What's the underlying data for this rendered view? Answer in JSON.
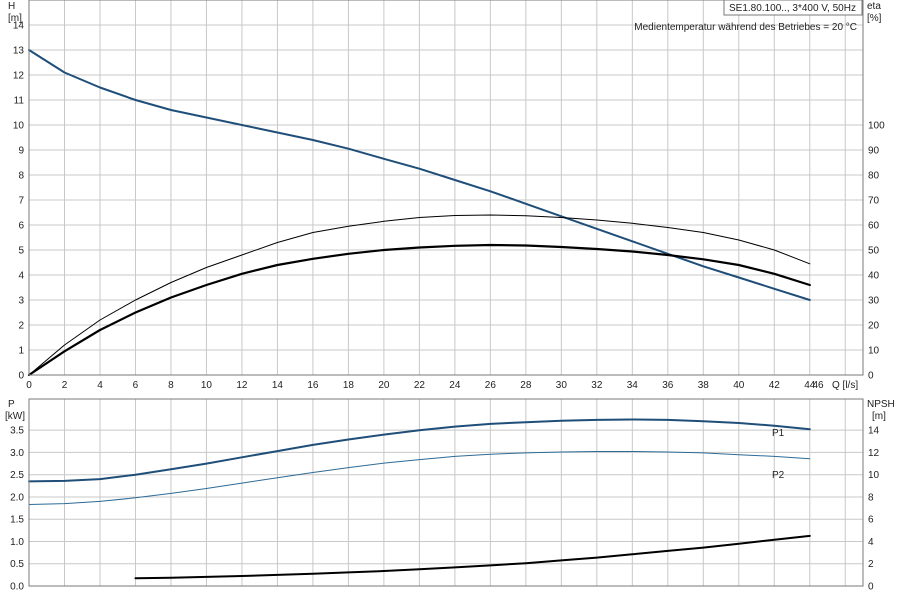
{
  "header": {
    "model": "SE1.80.100.., 3*400 V, 50Hz",
    "note": "Medientemperatur während des Betriebes = 20 °C"
  },
  "colors": {
    "head": "#1f4e79",
    "eta": "#000000",
    "p1": "#1f4e79",
    "p2": "#2e6a96",
    "npsh": "#000000",
    "grid": "#c8c8c8"
  },
  "chart_data": [
    {
      "type": "line",
      "xlabel": "Q [l/s]",
      "x_axis": {
        "label_prefix": "46",
        "label_unit": "Q [l/s]",
        "range": [
          0,
          47
        ],
        "ticks": [
          "0",
          "2",
          "4",
          "6",
          "8",
          "10",
          "12",
          "14",
          "16",
          "18",
          "20",
          "22",
          "24",
          "26",
          "28",
          "30",
          "32",
          "34",
          "36",
          "38",
          "40",
          "42",
          "44"
        ],
        "grid_step": 2
      },
      "y_left": {
        "label": "H",
        "unit": "[m]",
        "range": [
          0,
          15
        ],
        "ticks": [
          "0",
          "1",
          "2",
          "3",
          "4",
          "5",
          "6",
          "7",
          "8",
          "9",
          "10",
          "11",
          "12",
          "13",
          "14"
        ]
      },
      "y_right": {
        "label": "eta",
        "unit": "[%]",
        "range": [
          0,
          150
        ],
        "ticks": [
          "0",
          "10",
          "20",
          "30",
          "40",
          "50",
          "60",
          "70",
          "80",
          "90",
          "100"
        ]
      },
      "grid": true,
      "series": [
        {
          "key": "head",
          "axis": "left",
          "width": 2,
          "points": [
            [
              0,
              13.0
            ],
            [
              2,
              12.1
            ],
            [
              4,
              11.5
            ],
            [
              6,
              11.0
            ],
            [
              8,
              10.6
            ],
            [
              10,
              10.3
            ],
            [
              12,
              10.0
            ],
            [
              14,
              9.7
            ],
            [
              16,
              9.4
            ],
            [
              18,
              9.05
            ],
            [
              20,
              8.65
            ],
            [
              22,
              8.25
            ],
            [
              24,
              7.8
            ],
            [
              26,
              7.35
            ],
            [
              28,
              6.85
            ],
            [
              30,
              6.35
            ],
            [
              32,
              5.85
            ],
            [
              34,
              5.35
            ],
            [
              36,
              4.85
            ],
            [
              38,
              4.35
            ],
            [
              40,
              3.9
            ],
            [
              42,
              3.45
            ],
            [
              44,
              3.0
            ]
          ]
        },
        {
          "key": "eta_total",
          "axis": "right",
          "width": 2.2,
          "points": [
            [
              0,
              0
            ],
            [
              2,
              9.5
            ],
            [
              4,
              18
            ],
            [
              6,
              25
            ],
            [
              8,
              31
            ],
            [
              10,
              36
            ],
            [
              12,
              40.5
            ],
            [
              14,
              44
            ],
            [
              16,
              46.5
            ],
            [
              18,
              48.5
            ],
            [
              20,
              50
            ],
            [
              22,
              51
            ],
            [
              24,
              51.7
            ],
            [
              26,
              52
            ],
            [
              28,
              51.8
            ],
            [
              30,
              51.2
            ],
            [
              32,
              50.4
            ],
            [
              34,
              49.4
            ],
            [
              36,
              48
            ],
            [
              38,
              46.3
            ],
            [
              40,
              44
            ],
            [
              42,
              40.5
            ],
            [
              44,
              36
            ]
          ]
        },
        {
          "key": "eta_hydraulic",
          "axis": "right",
          "width": 1,
          "points": [
            [
              0,
              0
            ],
            [
              2,
              12
            ],
            [
              4,
              22
            ],
            [
              6,
              30
            ],
            [
              8,
              37
            ],
            [
              10,
              43
            ],
            [
              12,
              48
            ],
            [
              14,
              53
            ],
            [
              16,
              57
            ],
            [
              18,
              59.5
            ],
            [
              20,
              61.5
            ],
            [
              22,
              63
            ],
            [
              24,
              63.8
            ],
            [
              26,
              64
            ],
            [
              28,
              63.7
            ],
            [
              30,
              63
            ],
            [
              32,
              62
            ],
            [
              34,
              60.7
            ],
            [
              36,
              59
            ],
            [
              38,
              57
            ],
            [
              40,
              54
            ],
            [
              42,
              50
            ],
            [
              44,
              44.5
            ]
          ]
        }
      ]
    },
    {
      "type": "line",
      "x_axis": {
        "range": [
          0,
          47
        ],
        "grid_step": 2
      },
      "y_left": {
        "label": "P",
        "unit": "[kW]",
        "range": [
          0,
          4.2
        ],
        "ticks": [
          "0.0",
          "0.5",
          "1.0",
          "1.5",
          "2.0",
          "2.5",
          "3.0",
          "3.5"
        ]
      },
      "y_right": {
        "label": "NPSH",
        "unit": "[m]",
        "range": [
          0,
          16.8
        ],
        "ticks": [
          "0",
          "2",
          "4",
          "6",
          "8",
          "10",
          "12",
          "14"
        ]
      },
      "grid": true,
      "series": [
        {
          "key": "p1",
          "name": "P1",
          "axis": "left",
          "width": 2,
          "points": [
            [
              0,
              2.35
            ],
            [
              2,
              2.36
            ],
            [
              4,
              2.4
            ],
            [
              6,
              2.5
            ],
            [
              8,
              2.62
            ],
            [
              10,
              2.75
            ],
            [
              12,
              2.89
            ],
            [
              14,
              3.03
            ],
            [
              16,
              3.17
            ],
            [
              18,
              3.29
            ],
            [
              20,
              3.4
            ],
            [
              22,
              3.5
            ],
            [
              24,
              3.58
            ],
            [
              26,
              3.64
            ],
            [
              28,
              3.68
            ],
            [
              30,
              3.71
            ],
            [
              32,
              3.73
            ],
            [
              34,
              3.74
            ],
            [
              36,
              3.73
            ],
            [
              38,
              3.7
            ],
            [
              40,
              3.66
            ],
            [
              42,
              3.6
            ],
            [
              44,
              3.52
            ]
          ]
        },
        {
          "key": "p2",
          "name": "P2",
          "axis": "left",
          "width": 1,
          "points": [
            [
              0,
              1.83
            ],
            [
              2,
              1.85
            ],
            [
              4,
              1.9
            ],
            [
              6,
              1.98
            ],
            [
              8,
              2.08
            ],
            [
              10,
              2.19
            ],
            [
              12,
              2.31
            ],
            [
              14,
              2.43
            ],
            [
              16,
              2.55
            ],
            [
              18,
              2.66
            ],
            [
              20,
              2.76
            ],
            [
              22,
              2.84
            ],
            [
              24,
              2.91
            ],
            [
              26,
              2.96
            ],
            [
              28,
              2.99
            ],
            [
              30,
              3.01
            ],
            [
              32,
              3.02
            ],
            [
              34,
              3.02
            ],
            [
              36,
              3.01
            ],
            [
              38,
              2.99
            ],
            [
              40,
              2.95
            ],
            [
              42,
              2.91
            ],
            [
              44,
              2.86
            ]
          ]
        },
        {
          "key": "npsh",
          "axis": "right",
          "width": 2,
          "points": [
            [
              6,
              0.7
            ],
            [
              8,
              0.75
            ],
            [
              10,
              0.82
            ],
            [
              12,
              0.9
            ],
            [
              14,
              1.0
            ],
            [
              16,
              1.1
            ],
            [
              18,
              1.22
            ],
            [
              20,
              1.35
            ],
            [
              22,
              1.5
            ],
            [
              24,
              1.67
            ],
            [
              26,
              1.85
            ],
            [
              28,
              2.05
            ],
            [
              30,
              2.3
            ],
            [
              32,
              2.55
            ],
            [
              34,
              2.85
            ],
            [
              36,
              3.15
            ],
            [
              38,
              3.45
            ],
            [
              40,
              3.8
            ],
            [
              42,
              4.15
            ],
            [
              44,
              4.5
            ]
          ]
        }
      ]
    }
  ]
}
